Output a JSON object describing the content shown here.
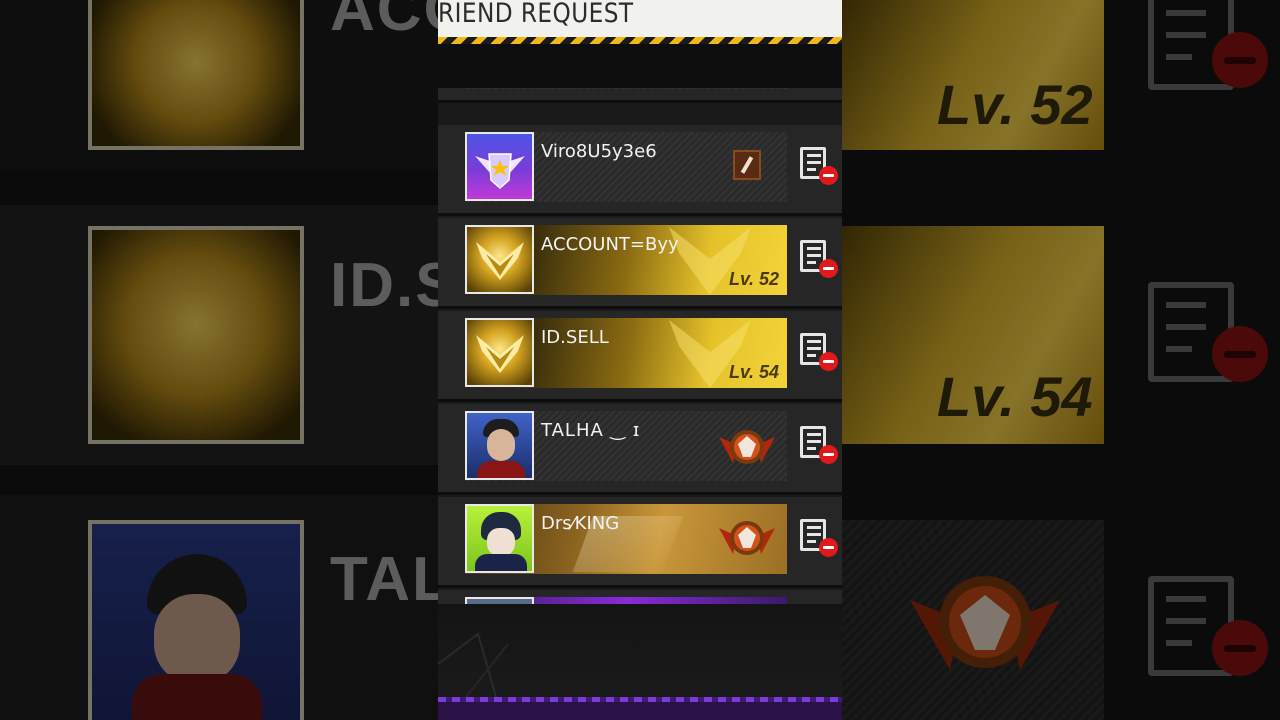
{
  "header": {
    "title": "RIEND REQUEST"
  },
  "requests": [
    {
      "name": "",
      "avatar": "partial-avatar",
      "partial": true
    },
    {
      "name": "Viro8U5y3e6",
      "avatar": "purple-star-wings-badge",
      "banner": "grey",
      "badge": "bullet-rank-icon"
    },
    {
      "name": "ACCOUNT=Byy",
      "avatar": "gold-wings-emblem",
      "banner": "gold",
      "level": "Lv. 52"
    },
    {
      "name": "ID.SELL",
      "avatar": "gold-wings-emblem",
      "banner": "gold",
      "level": "Lv. 54"
    },
    {
      "name": "TALHA ‿ ɪ",
      "avatar": "male-character-portrait",
      "banner": "grey",
      "badge": "heroic-rank-badge"
    },
    {
      "name": "Drs⁄KING",
      "avatar": "anime-character-portrait",
      "banner": "amber",
      "badge": "heroic-rank-badge"
    }
  ],
  "background": {
    "left_texts": [
      "ACC",
      "ID.S",
      "TAL"
    ],
    "right_levels": [
      "Lv. 52",
      "Lv. 54"
    ]
  },
  "colors": {
    "hazard_yellow": "#f2b81a",
    "decline_red": "#e01a1a",
    "gold": "#e5c22a"
  }
}
